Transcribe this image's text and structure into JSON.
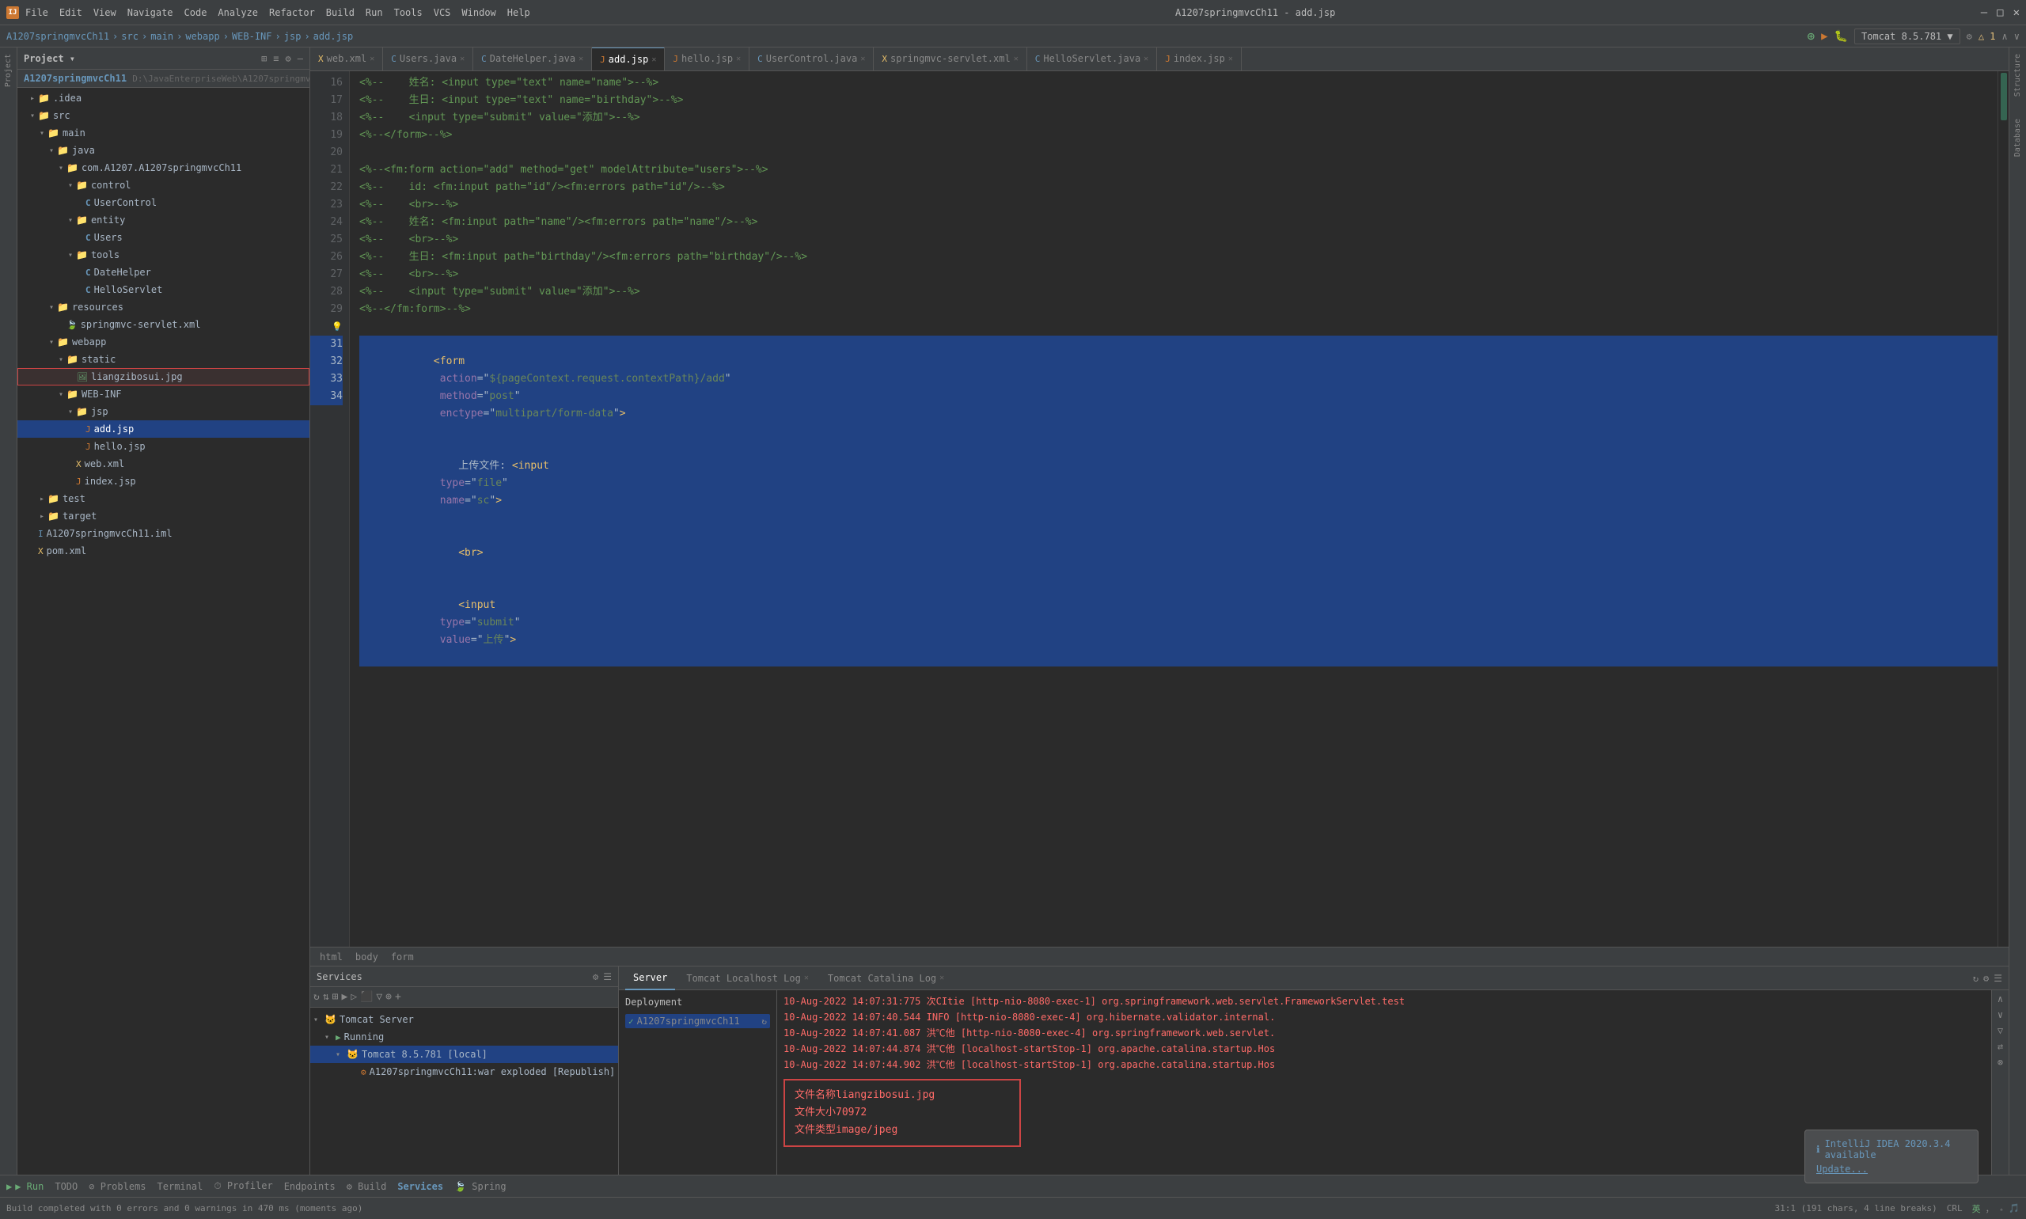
{
  "titlebar": {
    "app_icon": "IJ",
    "menu_items": [
      "File",
      "Edit",
      "View",
      "Navigate",
      "Code",
      "Analyze",
      "Refactor",
      "Build",
      "Run",
      "Tools",
      "VCS",
      "Window",
      "Help"
    ],
    "title": "A1207springmvcCh11 - add.jsp",
    "controls": [
      "—",
      "□",
      "✕"
    ]
  },
  "breadcrumb": {
    "items": [
      "A1207springmvcCh11",
      "src",
      "main",
      "webapp",
      "WEB-INF",
      "jsp",
      "add.jsp"
    ]
  },
  "project_panel": {
    "title": "Project",
    "toolbar_icons": [
      "⊞",
      "≡",
      "⚙",
      "—"
    ],
    "root_label": "A1207springmvcCh11",
    "root_path": "D:\\JavaEnterpriseWeb\\A1207springmvc..."
  },
  "tree_items": [
    {
      "id": "project-root",
      "indent": 0,
      "arrow": "▾",
      "icon": "📁",
      "icon_class": "folder-icon",
      "label": "Project ▾",
      "type": "root"
    },
    {
      "id": "idea",
      "indent": 1,
      "arrow": "▸",
      "icon": "📁",
      "icon_class": "folder-icon",
      "label": ".idea",
      "type": "folder"
    },
    {
      "id": "src",
      "indent": 1,
      "arrow": "▾",
      "icon": "📁",
      "icon_class": "folder-icon",
      "label": "src",
      "type": "folder"
    },
    {
      "id": "main",
      "indent": 2,
      "arrow": "▾",
      "icon": "📁",
      "icon_class": "folder-icon",
      "label": "main",
      "type": "folder"
    },
    {
      "id": "java",
      "indent": 3,
      "arrow": "▾",
      "icon": "📁",
      "icon_class": "folder-icon",
      "label": "java",
      "type": "folder"
    },
    {
      "id": "com",
      "indent": 4,
      "arrow": "▾",
      "icon": "📁",
      "icon_class": "folder-icon",
      "label": "com.A1207.A1207springmvcCh11",
      "type": "folder"
    },
    {
      "id": "control",
      "indent": 5,
      "arrow": "▾",
      "icon": "📁",
      "icon_class": "folder-icon",
      "label": "control",
      "type": "folder"
    },
    {
      "id": "usercontrol",
      "indent": 6,
      "arrow": "",
      "icon": "C",
      "icon_class": "java-icon",
      "label": "UserControl",
      "type": "java"
    },
    {
      "id": "entity",
      "indent": 5,
      "arrow": "▾",
      "icon": "📁",
      "icon_class": "folder-icon",
      "label": "entity",
      "type": "folder"
    },
    {
      "id": "users",
      "indent": 6,
      "arrow": "",
      "icon": "C",
      "icon_class": "java-icon",
      "label": "Users",
      "type": "java"
    },
    {
      "id": "tools",
      "indent": 5,
      "arrow": "▾",
      "icon": "📁",
      "icon_class": "folder-icon",
      "label": "tools",
      "type": "folder"
    },
    {
      "id": "datehelper",
      "indent": 6,
      "arrow": "",
      "icon": "C",
      "icon_class": "java-icon",
      "label": "DateHelper",
      "type": "java"
    },
    {
      "id": "helloservlet",
      "indent": 6,
      "arrow": "",
      "icon": "C",
      "icon_class": "java-icon",
      "label": "HelloServlet",
      "type": "java"
    },
    {
      "id": "resources",
      "indent": 3,
      "arrow": "▾",
      "icon": "📁",
      "icon_class": "folder-icon",
      "label": "resources",
      "type": "folder"
    },
    {
      "id": "springmvc-servlet",
      "indent": 4,
      "arrow": "",
      "icon": "X",
      "icon_class": "xml-icon",
      "label": "springmvc-servlet.xml",
      "type": "xml"
    },
    {
      "id": "webapp",
      "indent": 3,
      "arrow": "▾",
      "icon": "📁",
      "icon_class": "folder-icon",
      "label": "webapp",
      "type": "folder"
    },
    {
      "id": "static",
      "indent": 4,
      "arrow": "▾",
      "icon": "📁",
      "icon_class": "folder-icon",
      "label": "static",
      "type": "folder"
    },
    {
      "id": "liangzibosui",
      "indent": 5,
      "arrow": "",
      "icon": "🖼",
      "icon_class": "img-icon",
      "label": "liangzibosui.jpg",
      "type": "img",
      "highlighted": true
    },
    {
      "id": "webinf",
      "indent": 4,
      "arrow": "▾",
      "icon": "📁",
      "icon_class": "folder-icon",
      "label": "WEB-INF",
      "type": "folder"
    },
    {
      "id": "jsp",
      "indent": 5,
      "arrow": "▾",
      "icon": "📁",
      "icon_class": "folder-icon",
      "label": "jsp",
      "type": "folder"
    },
    {
      "id": "add-jsp",
      "indent": 6,
      "arrow": "",
      "icon": "J",
      "icon_class": "jsp-icon",
      "label": "add.jsp",
      "type": "jsp",
      "selected": true
    },
    {
      "id": "hello-jsp",
      "indent": 6,
      "arrow": "",
      "icon": "J",
      "icon_class": "jsp-icon",
      "label": "hello.jsp",
      "type": "jsp"
    },
    {
      "id": "web-xml",
      "indent": 5,
      "arrow": "",
      "icon": "X",
      "icon_class": "xml-icon",
      "label": "web.xml",
      "type": "xml"
    },
    {
      "id": "index-jsp",
      "indent": 5,
      "arrow": "",
      "icon": "J",
      "icon_class": "jsp-icon",
      "label": "index.jsp",
      "type": "jsp"
    },
    {
      "id": "test",
      "indent": 2,
      "arrow": "▸",
      "icon": "📁",
      "icon_class": "folder-icon",
      "label": "test",
      "type": "folder"
    },
    {
      "id": "target",
      "indent": 2,
      "arrow": "▸",
      "icon": "📁",
      "icon_class": "folder-icon",
      "label": "target",
      "type": "folder"
    },
    {
      "id": "a1207iml",
      "indent": 1,
      "arrow": "",
      "icon": "I",
      "icon_class": "iml-icon",
      "label": "A1207springmvcCh11.iml",
      "type": "iml"
    },
    {
      "id": "pomxml",
      "indent": 1,
      "arrow": "",
      "icon": "X",
      "icon_class": "xml-icon",
      "label": "pom.xml",
      "type": "xml"
    }
  ],
  "editor_tabs": [
    {
      "id": "webxml",
      "label": "web.xml",
      "icon": "X",
      "active": false
    },
    {
      "id": "usersjava",
      "label": "Users.java",
      "icon": "C",
      "active": false
    },
    {
      "id": "datehelper",
      "label": "DateHelper.java",
      "icon": "C",
      "active": false
    },
    {
      "id": "addjsp",
      "label": "add.jsp",
      "icon": "J",
      "active": true
    },
    {
      "id": "hellojsp",
      "label": "hello.jsp",
      "icon": "J",
      "active": false
    },
    {
      "id": "usercontrol",
      "label": "UserControl.java",
      "icon": "C",
      "active": false
    },
    {
      "id": "springmvc",
      "label": "springmvc-servlet.xml",
      "icon": "X",
      "active": false
    },
    {
      "id": "helloservlet",
      "label": "HelloServlet.java",
      "icon": "C",
      "active": false
    },
    {
      "id": "indexjsp",
      "label": "index.jsp",
      "icon": "J",
      "active": false
    }
  ],
  "code_lines": [
    {
      "num": 16,
      "content": "<%--    姓名: <input type=\"text\" name=\"name\">--%>",
      "selected": false
    },
    {
      "num": 17,
      "content": "<%--    生日: <input type=\"text\" name=\"birthday\">--%>",
      "selected": false
    },
    {
      "num": 18,
      "content": "<%--    <input type=\"submit\" value=\"添加\">--%>",
      "selected": false
    },
    {
      "num": 19,
      "content": "<%--</form>--%>",
      "selected": false
    },
    {
      "num": 20,
      "content": "",
      "selected": false
    },
    {
      "num": 21,
      "content": "<%--<fm:form action=\"add\" method=\"get\" modelAttribute=\"users\">--%>",
      "selected": false
    },
    {
      "num": 22,
      "content": "<%--    id: <fm:input path=\"id\"/><fm:errors path=\"id\"/>--%>",
      "selected": false
    },
    {
      "num": 23,
      "content": "<%--    <br>--%>",
      "selected": false
    },
    {
      "num": 24,
      "content": "<%--    姓名: <fm:input path=\"name\"/><fm:errors path=\"name\"/>--%>",
      "selected": false
    },
    {
      "num": 25,
      "content": "<%--    <br>--%>",
      "selected": false
    },
    {
      "num": 26,
      "content": "<%--    生日: <fm:input path=\"birthday\"/><fm:errors path=\"birthday\"/>--%>",
      "selected": false
    },
    {
      "num": 27,
      "content": "<%--    <br>--%>",
      "selected": false
    },
    {
      "num": 28,
      "content": "<%--    <input type=\"submit\" value=\"添加\">--%>",
      "selected": false
    },
    {
      "num": 29,
      "content": "<%--</fm:form>--%>",
      "selected": false
    },
    {
      "num": 30,
      "content": "💡",
      "selected": false
    },
    {
      "num": 31,
      "content": "<form action=\"${pageContext.request.contextPath}/add\" method=\"post\" enctype=\"multipart/form-data\">",
      "selected": true
    },
    {
      "num": 32,
      "content": "    上传文件: <input type=\"file\" name=\"sc\">",
      "selected": true
    },
    {
      "num": 33,
      "content": "    <br>",
      "selected": true
    },
    {
      "num": 34,
      "content": "    <input type=\"submit\" value=\"上传\">",
      "selected": true
    }
  ],
  "editor_bottom": {
    "html": "html",
    "body": "body",
    "form": "form"
  },
  "services": {
    "title": "Services",
    "toolbar_icons": [
      "↻",
      "⇅",
      "⊞",
      "▶",
      "▷",
      "⬛",
      "⏹",
      "+"
    ],
    "tree": [
      {
        "indent": 0,
        "arrow": "▾",
        "label": "Tomcat Server",
        "icon": "🐱"
      },
      {
        "indent": 1,
        "arrow": "▾",
        "label": "Running",
        "icon": "▶",
        "color": "#6aac76"
      },
      {
        "indent": 2,
        "arrow": "▾",
        "label": "Tomcat 8.5.781 [local]",
        "icon": "🐱"
      },
      {
        "indent": 3,
        "arrow": "",
        "label": "A1207springmvcCh11:war exploded [Republish]",
        "icon": "⚙"
      }
    ]
  },
  "server_tabs": [
    {
      "label": "Server",
      "active": true
    },
    {
      "label": "Tomcat Localhost Log",
      "active": false,
      "closable": true
    },
    {
      "label": "Tomcat Catalina Log",
      "active": false,
      "closable": true
    }
  ],
  "deployment": {
    "label": "Deployment",
    "item": "A1207springmvcCh11"
  },
  "output_lines": [
    {
      "text": "10-Aug-2022 14:07:31:775 次CItie [http-nio-8080-exec-1] org.springframework.web.servlet.FrameworkServlet.test",
      "class": "output-red"
    },
    {
      "text": "10-Aug-2022 14:07:40.544 INFO [http-nio-8080-exec-4] org.hibernate.validator.internal.",
      "class": "output-red"
    },
    {
      "text": "10-Aug-2022 14:07:41.087 洪℃他 [http-nio-8080-exec-4] org.springframework.web.servlet.",
      "class": "output-red"
    },
    {
      "text": "10-Aug-2022 14:07:44.874 洪℃他 [localhost-startStop-1] org.apache.catalina.startup.Hos",
      "class": "output-red"
    },
    {
      "text": "10-Aug-2022 14:07:44.902 洪℃他 [localhost-startStop-1] org.apache.catalina.startup.Hos",
      "class": "output-red"
    }
  ],
  "file_info": {
    "filename_label": "文件名称",
    "filename_value": "liangzibosui.jpg",
    "filesize_label": "文件大小",
    "filesize_value": "70972",
    "filetype_label": "文件类型",
    "filetype_value": "image/jpeg"
  },
  "notification": {
    "icon": "ℹ",
    "title": "IntelliJ IDEA 2020.3.4 available",
    "link": "Update..."
  },
  "status_bar": {
    "left_text": "Build completed with 0 errors and 0 warnings in 470 ms (moments ago)",
    "position": "31:1 (191 chars, 4 line breaks)",
    "encoding": "CRL",
    "run_label": "▶ Run",
    "todo_label": "TODO",
    "problems_label": "⊘ Problems",
    "terminal_label": "Terminal",
    "profiler_label": "⏱ Profiler",
    "endpoints_label": "Endpoints",
    "build_label": "⚙ Build",
    "services_label": "Services",
    "spring_label": "🍃 Spring"
  },
  "tomcat_badge": {
    "label": "Tomcat 8.5.781 ▼"
  },
  "right_panel_icons": {
    "structure": "Structure",
    "database": "Database"
  }
}
